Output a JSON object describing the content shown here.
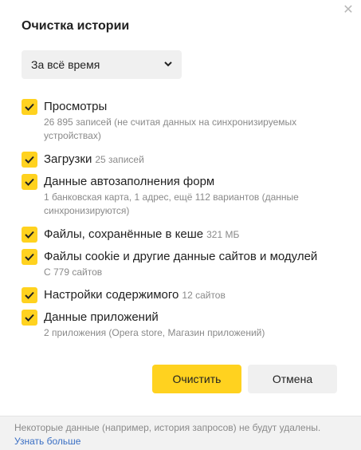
{
  "dialog": {
    "title": "Очистка истории",
    "close_icon": "✕"
  },
  "period": {
    "value": "За всё время"
  },
  "items": [
    {
      "label": "Просмотры",
      "inline_meta": "",
      "desc": "26 895 записей (не считая данных на синхронизируемых устройствах)",
      "checked": true
    },
    {
      "label": "Загрузки",
      "inline_meta": "25 записей",
      "desc": "",
      "checked": true
    },
    {
      "label": "Данные автозаполнения форм",
      "inline_meta": "",
      "desc": "1 банковская карта, 1 адрес, ещё 112 вариантов (данные синхронизируются)",
      "checked": true
    },
    {
      "label": "Файлы, сохранённые в кеше",
      "inline_meta": "321 МБ",
      "desc": "",
      "checked": true
    },
    {
      "label": "Файлы cookie и другие данные сайтов и модулей",
      "inline_meta": "",
      "desc": "С 779 сайтов",
      "checked": true
    },
    {
      "label": "Настройки содержимого",
      "inline_meta": "12 сайтов",
      "desc": "",
      "checked": true
    },
    {
      "label": "Данные приложений",
      "inline_meta": "",
      "desc": "2 приложения (Opera store, Магазин приложений)",
      "checked": true
    }
  ],
  "buttons": {
    "clear": "Очистить",
    "cancel": "Отмена"
  },
  "footer": {
    "note": "Некоторые данные (например, история запросов) не будут удалены.",
    "link": "Узнать больше"
  },
  "colors": {
    "accent": "#ffd21f",
    "link": "#3a6fc4"
  }
}
